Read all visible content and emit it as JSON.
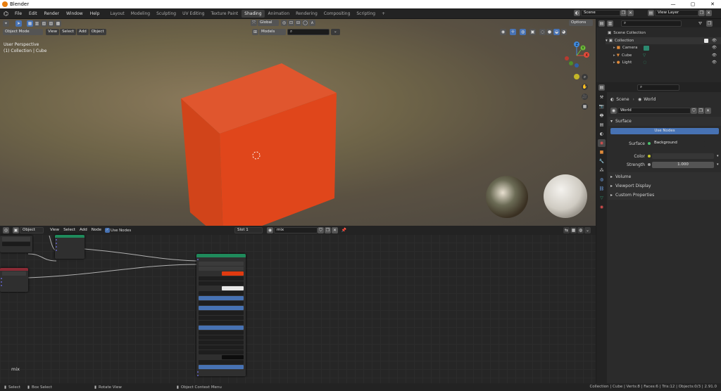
{
  "window": {
    "title": "Blender",
    "minimize": "—",
    "maximize": "▢",
    "close": "✕"
  },
  "menubar": {
    "items": [
      "File",
      "Edit",
      "Render",
      "Window",
      "Help"
    ]
  },
  "workspaces": {
    "tabs": [
      "Layout",
      "Modeling",
      "Sculpting",
      "UV Editing",
      "Texture Paint",
      "Shading",
      "Animation",
      "Rendering",
      "Compositing",
      "Scripting"
    ],
    "active": "Shading",
    "add": "+"
  },
  "scene": {
    "name": "Scene",
    "view_layer": "View Layer"
  },
  "viewport": {
    "mode": "Object Mode",
    "menu": [
      "View",
      "Select",
      "Add",
      "Object"
    ],
    "orientation": "Global",
    "env_select": "Models",
    "options": "Options",
    "perspective": "User Perspective",
    "collection": "(1) Collection | Cube",
    "gizmo": {
      "x": "X",
      "y": "Y",
      "z": "Z"
    }
  },
  "node_editor": {
    "type": "Object",
    "menu": [
      "View",
      "Select",
      "Add",
      "Node"
    ],
    "use_nodes": "Use Nodes",
    "slot": "Slot 1",
    "material": "mix",
    "label": "mix"
  },
  "outliner": {
    "root": "Scene Collection",
    "collection": "Collection",
    "items": [
      {
        "name": "Camera",
        "color": "#e08a3a"
      },
      {
        "name": "Cube",
        "color": "#e08a3a"
      },
      {
        "name": "Light",
        "color": "#e08a3a"
      }
    ]
  },
  "properties": {
    "breadcrumb_scene": "Scene",
    "breadcrumb_world": "World",
    "world_name": "World",
    "surface_panel": "Surface",
    "use_nodes": "Use Nodes",
    "surface_label": "Surface",
    "surface_value": "Background",
    "color_label": "Color",
    "strength_label": "Strength",
    "strength_value": "1.000",
    "panels": [
      "Volume",
      "Viewport Display",
      "Custom Properties"
    ]
  },
  "statusbar": {
    "select": "Select",
    "box_select": "Box Select",
    "rotate_view": "Rotate View",
    "context_menu": "Object Context Menu",
    "stats": "Collection | Cube | Verts:8 | Faces:6 | Tris:12 | Objects:0/3 | 2.91.0"
  },
  "colors": {
    "accent": "#4772b3",
    "cube": "#e0481f",
    "bsdf_header": "#1f8a5b",
    "output_header": "#8a2a35"
  }
}
